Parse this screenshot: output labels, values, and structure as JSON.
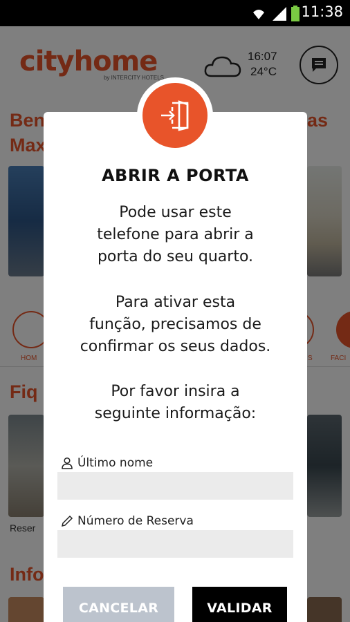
{
  "status_bar": {
    "time": "11:38"
  },
  "header": {
    "logo": "cityhome",
    "logo_sub": "by INTERCITY HOTELS",
    "weather_time": "16:07",
    "weather_temp": "24°C"
  },
  "background": {
    "welcome_line1_left": "Ben",
    "welcome_line1_right": "as",
    "welcome_line2": "Max",
    "nav_home": "HOM",
    "nav_s": "S",
    "nav_fac": "FACI",
    "section2": "Fiq",
    "caption": "Reser",
    "section3": "Info"
  },
  "dialog": {
    "title": "ABRIR A PORTA",
    "para1": [
      "Pode usar este",
      "telefone para abrir a",
      "porta do seu quarto."
    ],
    "para2": [
      "Para ativar esta",
      "função, precisamos de",
      "confirmar os seus dados."
    ],
    "para3": [
      "Por favor insira a",
      "seguinte informação:"
    ],
    "field1_label": "Último nome",
    "field1_value": "",
    "field2_label": "Número de Reserva",
    "field2_value": "",
    "cancel_label": "CANCELAR",
    "ok_label": "VALIDAR"
  },
  "colors": {
    "accent": "#e8542a",
    "cancel_bg": "#bcc3cd",
    "ok_bg": "#000000"
  },
  "icons": {
    "door": "door-enter-icon",
    "user": "person-icon",
    "pencil": "pencil-icon",
    "cloud": "cloud-icon",
    "chat": "chat-icon"
  }
}
